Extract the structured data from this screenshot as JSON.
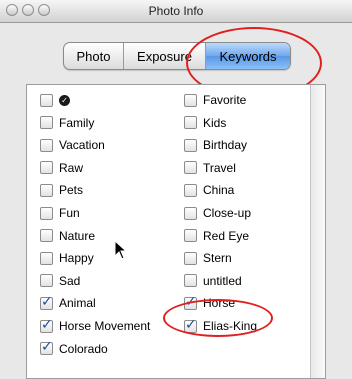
{
  "window": {
    "title": "Photo Info"
  },
  "tabs": [
    {
      "label": "Photo",
      "selected": false
    },
    {
      "label": "Exposure",
      "selected": false
    },
    {
      "label": "Keywords",
      "selected": true
    }
  ],
  "keywords": {
    "left": [
      {
        "label": "",
        "icon": "checkmark-seal-icon",
        "checked": false
      },
      {
        "label": "Family",
        "checked": false
      },
      {
        "label": "Vacation",
        "checked": false
      },
      {
        "label": "Raw",
        "checked": false
      },
      {
        "label": "Pets",
        "checked": false
      },
      {
        "label": "Fun",
        "checked": false
      },
      {
        "label": "Nature",
        "checked": false
      },
      {
        "label": "Happy",
        "checked": false
      },
      {
        "label": "Sad",
        "checked": false
      },
      {
        "label": "Animal",
        "checked": true
      },
      {
        "label": "Horse Movement",
        "checked": true
      },
      {
        "label": "Colorado",
        "checked": true
      }
    ],
    "right": [
      {
        "label": "Favorite",
        "checked": false
      },
      {
        "label": "Kids",
        "checked": false
      },
      {
        "label": "Birthday",
        "checked": false
      },
      {
        "label": "Travel",
        "checked": false
      },
      {
        "label": "China",
        "checked": false
      },
      {
        "label": "Close-up",
        "checked": false
      },
      {
        "label": "Red Eye",
        "checked": false
      },
      {
        "label": "Stern",
        "checked": false
      },
      {
        "label": "untitled",
        "checked": false
      },
      {
        "label": "Horse",
        "checked": true
      },
      {
        "label": "Elias-King",
        "checked": true
      }
    ]
  },
  "colors": {
    "annotation": "#e0201f",
    "selected_tab": "#6fa8ec",
    "check": "#1d4f9a"
  }
}
